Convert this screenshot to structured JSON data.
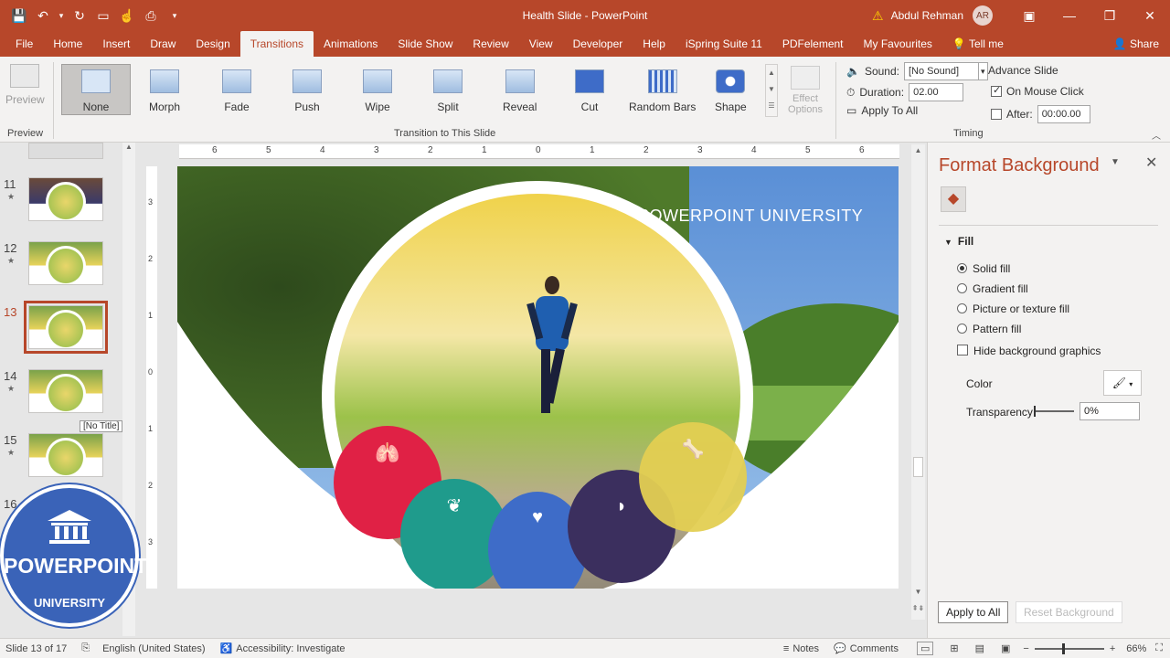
{
  "window": {
    "title": "Health Slide - PowerPoint",
    "user": "Abdul Rehman",
    "avatar_initials": "AR"
  },
  "menu": {
    "tabs": [
      "File",
      "Home",
      "Insert",
      "Draw",
      "Design",
      "Transitions",
      "Animations",
      "Slide Show",
      "Review",
      "View",
      "Developer",
      "Help",
      "iSpring Suite 11",
      "PDFelement",
      "My Favourites"
    ],
    "active": "Transitions",
    "tell_me": "Tell me",
    "share": "Share"
  },
  "ribbon": {
    "preview_label": "Preview",
    "preview_group": "Preview",
    "transitions": [
      "None",
      "Morph",
      "Fade",
      "Push",
      "Wipe",
      "Split",
      "Reveal",
      "Cut",
      "Random Bars",
      "Shape"
    ],
    "effect_options": "Effect Options",
    "transition_group": "Transition to This Slide",
    "sound_label": "Sound:",
    "sound_value": "[No Sound]",
    "duration_label": "Duration:",
    "duration_value": "02.00",
    "apply_all": "Apply To All",
    "advance_label": "Advance Slide",
    "on_click": "On Mouse Click",
    "after_label": "After:",
    "after_value": "00:00.00",
    "timing_group": "Timing"
  },
  "slides_panel": {
    "items": [
      {
        "num": "11"
      },
      {
        "num": "12"
      },
      {
        "num": "13"
      },
      {
        "num": "14"
      },
      {
        "num": "15"
      },
      {
        "num": "16"
      }
    ],
    "tooltip": "[No Title]"
  },
  "logo": {
    "line1": "POWERPOINT",
    "line2": "UNIVERSITY"
  },
  "ruler": {
    "h": [
      "6",
      "5",
      "4",
      "3",
      "2",
      "1",
      "0",
      "1",
      "2",
      "3",
      "4",
      "5",
      "6"
    ],
    "v": [
      "3",
      "2",
      "1",
      "0",
      "1",
      "2",
      "3"
    ]
  },
  "slide": {
    "heading": "POWERPOINT UNIVERSITY"
  },
  "format_pane": {
    "title": "Format Background",
    "section": "Fill",
    "options": [
      "Solid fill",
      "Gradient fill",
      "Picture or texture fill",
      "Pattern fill"
    ],
    "hide_bg": "Hide background graphics",
    "color_label": "Color",
    "transparency_label": "Transparency",
    "transparency_value": "0%",
    "apply_all": "Apply to All",
    "reset": "Reset Background"
  },
  "status": {
    "slide_info": "Slide 13 of 17",
    "language": "English (United States)",
    "accessibility": "Accessibility: Investigate",
    "notes": "Notes",
    "comments": "Comments",
    "zoom": "66%"
  },
  "colors": {
    "accent": "#b7472a",
    "red": "#e02145",
    "teal": "#1f9b8c",
    "blue": "#3e6cc8",
    "navy": "#3b2f5e",
    "yellow": "#e3cf52"
  }
}
